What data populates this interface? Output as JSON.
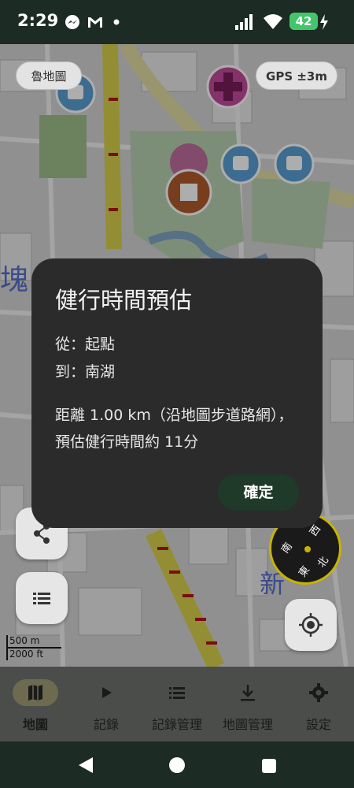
{
  "status_bar": {
    "time": "2:29",
    "battery": "42"
  },
  "map": {
    "layer_chip": "魯地圖",
    "gps_chip": "GPS ±3m",
    "scale": {
      "metric": "500 m",
      "imperial": "2000 ft"
    },
    "compass": {
      "west": "西",
      "north": "北",
      "south": "南",
      "east": "東"
    },
    "labels": {
      "left_char": "塊",
      "right_char": "新"
    }
  },
  "dialog": {
    "title": "健行時間預估",
    "from_line": "從：起點",
    "to_line": "到：南湖",
    "message": "距離 1.00 km（沿地圖步道路網），預估健行時間約 11分",
    "confirm_label": "確定"
  },
  "bottom_nav": {
    "items": [
      {
        "label": "地圖",
        "icon": "map-icon",
        "active": true
      },
      {
        "label": "記錄",
        "icon": "play-icon",
        "active": false
      },
      {
        "label": "記錄管理",
        "icon": "list-icon",
        "active": false
      },
      {
        "label": "地圖管理",
        "icon": "download-icon",
        "active": false
      },
      {
        "label": "設定",
        "icon": "gear-icon",
        "active": false
      }
    ]
  },
  "colors": {
    "accent": "#1f3a29",
    "dialog_bg": "#2b2b2b",
    "nav_active": "#6d6a50"
  }
}
